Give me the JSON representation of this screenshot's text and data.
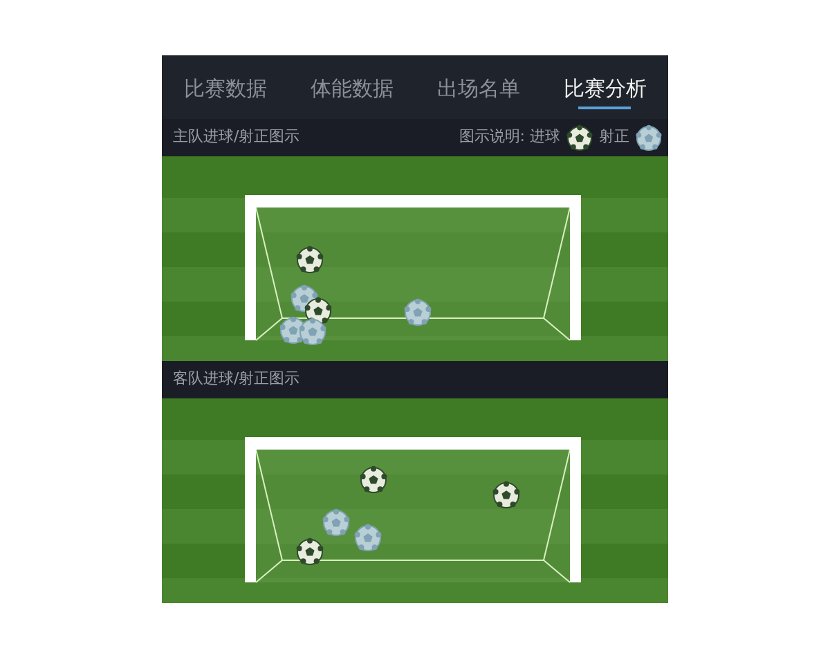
{
  "tabs": [
    {
      "label": "比赛数据",
      "selected": false
    },
    {
      "label": "体能数据",
      "selected": false
    },
    {
      "label": "出场名单",
      "selected": false
    },
    {
      "label": "比赛分析",
      "selected": true
    }
  ],
  "legend": {
    "title": "图示说明: 进球",
    "on_target_label": "射正"
  },
  "sections": [
    {
      "title": "主队进球/射正图示",
      "shots": [
        {
          "kind": "goal"
        },
        {
          "kind": "on_target"
        },
        {
          "kind": "goal"
        },
        {
          "kind": "on_target"
        },
        {
          "kind": "on_target"
        },
        {
          "kind": "on_target"
        }
      ]
    },
    {
      "title": "客队进球/射正图示",
      "shots": [
        {
          "kind": "goal"
        },
        {
          "kind": "goal"
        },
        {
          "kind": "on_target"
        },
        {
          "kind": "on_target"
        },
        {
          "kind": "goal"
        }
      ]
    }
  ]
}
